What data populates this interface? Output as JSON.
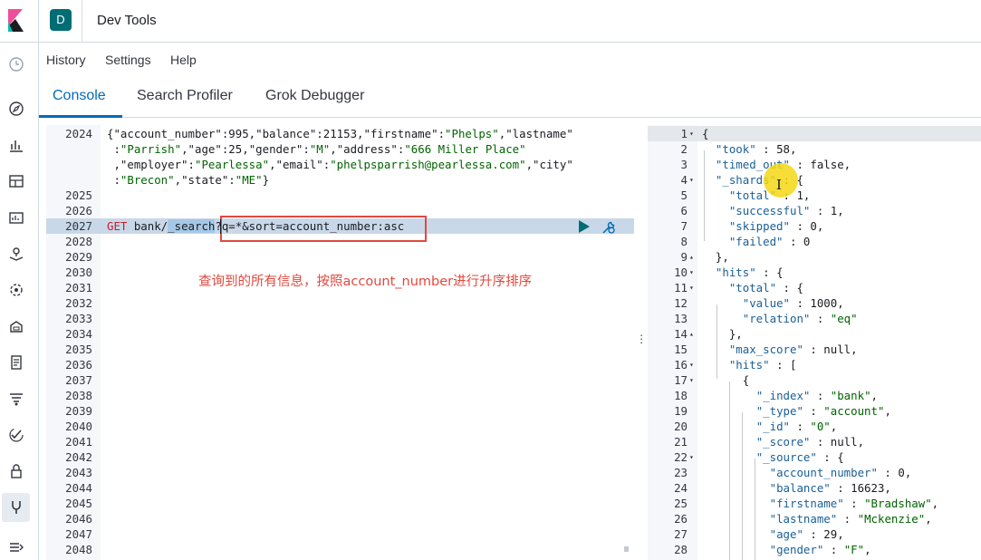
{
  "header": {
    "space_initial": "D",
    "title": "Dev Tools"
  },
  "menu": {
    "history": "History",
    "settings": "Settings",
    "help": "Help"
  },
  "tabs": {
    "console": "Console",
    "search_profiler": "Search Profiler",
    "grok_debugger": "Grok Debugger"
  },
  "left_nav_icons": [
    "clock-icon",
    "discover-compass-icon",
    "visualize-icon",
    "dashboard-icon",
    "canvas-icon",
    "maps-icon",
    "ml-icon",
    "infrastructure-icon",
    "logs-icon",
    "apm-icon",
    "uptime-icon",
    "siem-icon",
    "dev-tools-icon",
    "collapse-menu-icon"
  ],
  "editor": {
    "lines": [
      {
        "num": "2024",
        "tokens": [
          {
            "t": "{",
            "c": "n"
          },
          {
            "t": "\"account_number\"",
            "c": "k"
          },
          {
            "t": ":995,",
            "c": "n"
          },
          {
            "t": "\"balance\"",
            "c": "k"
          },
          {
            "t": ":21153,",
            "c": "n"
          },
          {
            "t": "\"firstname\"",
            "c": "k"
          },
          {
            "t": ":",
            "c": "n"
          },
          {
            "t": "\"Phelps\"",
            "c": "s"
          },
          {
            "t": ",",
            "c": "n"
          },
          {
            "t": "\"lastname\"",
            "c": "k"
          }
        ]
      },
      {
        "num": "",
        "tokens": [
          {
            "t": " :",
            "c": "n"
          },
          {
            "t": "\"Parrish\"",
            "c": "s"
          },
          {
            "t": ",",
            "c": "n"
          },
          {
            "t": "\"age\"",
            "c": "k"
          },
          {
            "t": ":25,",
            "c": "n"
          },
          {
            "t": "\"gender\"",
            "c": "k"
          },
          {
            "t": ":",
            "c": "n"
          },
          {
            "t": "\"M\"",
            "c": "s"
          },
          {
            "t": ",",
            "c": "n"
          },
          {
            "t": "\"address\"",
            "c": "k"
          },
          {
            "t": ":",
            "c": "n"
          },
          {
            "t": "\"666 Miller Place\"",
            "c": "s"
          }
        ]
      },
      {
        "num": "",
        "tokens": [
          {
            "t": " ,",
            "c": "n"
          },
          {
            "t": "\"employer\"",
            "c": "k"
          },
          {
            "t": ":",
            "c": "n"
          },
          {
            "t": "\"Pearlessa\"",
            "c": "s"
          },
          {
            "t": ",",
            "c": "n"
          },
          {
            "t": "\"email\"",
            "c": "k"
          },
          {
            "t": ":",
            "c": "n"
          },
          {
            "t": "\"phelpsparrish@pearlessa.com\"",
            "c": "s"
          },
          {
            "t": ",",
            "c": "n"
          },
          {
            "t": "\"city\"",
            "c": "k"
          }
        ]
      },
      {
        "num": "",
        "tokens": [
          {
            "t": " :",
            "c": "n"
          },
          {
            "t": "\"Brecon\"",
            "c": "s"
          },
          {
            "t": ",",
            "c": "n"
          },
          {
            "t": "\"state\"",
            "c": "k"
          },
          {
            "t": ":",
            "c": "n"
          },
          {
            "t": "\"ME\"",
            "c": "s"
          },
          {
            "t": "}",
            "c": "n"
          }
        ]
      },
      {
        "num": "2025",
        "tokens": []
      },
      {
        "num": "2026",
        "tokens": []
      },
      {
        "num": "2027",
        "active": true,
        "tokens": [
          {
            "t": "GET ",
            "c": "method"
          },
          {
            "t": "bank/",
            "c": "url"
          },
          {
            "t": "_search",
            "c": "search-word"
          },
          {
            "t": "?q=*&sort=account_number:asc",
            "c": "url"
          }
        ]
      },
      {
        "num": "2028",
        "tokens": []
      },
      {
        "num": "2029",
        "tokens": []
      },
      {
        "num": "2030",
        "tokens": []
      },
      {
        "num": "2031",
        "tokens": []
      },
      {
        "num": "2032",
        "tokens": []
      },
      {
        "num": "2033",
        "tokens": []
      },
      {
        "num": "2034",
        "tokens": []
      },
      {
        "num": "2035",
        "tokens": []
      },
      {
        "num": "2036",
        "tokens": []
      },
      {
        "num": "2037",
        "tokens": []
      },
      {
        "num": "2038",
        "tokens": []
      },
      {
        "num": "2039",
        "tokens": []
      },
      {
        "num": "2040",
        "tokens": []
      },
      {
        "num": "2041",
        "tokens": []
      },
      {
        "num": "2042",
        "tokens": []
      },
      {
        "num": "2043",
        "tokens": []
      },
      {
        "num": "2044",
        "tokens": []
      },
      {
        "num": "2045",
        "tokens": []
      },
      {
        "num": "2046",
        "tokens": []
      },
      {
        "num": "2047",
        "tokens": []
      },
      {
        "num": "2048",
        "tokens": []
      }
    ],
    "annotation": "查询到的所有信息，按照account_number进行升序排序"
  },
  "output": {
    "lines": [
      {
        "num": "1",
        "fold": "▾",
        "hl": true,
        "tokens": [
          {
            "t": "{",
            "c": "n"
          }
        ]
      },
      {
        "num": "2",
        "tokens": [
          {
            "t": "  ",
            "c": "n"
          },
          {
            "t": "\"took\"",
            "c": "ok"
          },
          {
            "t": " : 58,",
            "c": "n"
          }
        ]
      },
      {
        "num": "3",
        "tokens": [
          {
            "t": "  ",
            "c": "n"
          },
          {
            "t": "\"timed_out\"",
            "c": "ok"
          },
          {
            "t": " : false,",
            "c": "n"
          }
        ]
      },
      {
        "num": "4",
        "fold": "▾",
        "tokens": [
          {
            "t": "  ",
            "c": "n"
          },
          {
            "t": "\"_shards\"",
            "c": "ok"
          },
          {
            "t": " : {",
            "c": "n"
          }
        ]
      },
      {
        "num": "5",
        "tokens": [
          {
            "t": "    ",
            "c": "n"
          },
          {
            "t": "\"total\"",
            "c": "ok"
          },
          {
            "t": " : 1,",
            "c": "n"
          }
        ]
      },
      {
        "num": "6",
        "tokens": [
          {
            "t": "    ",
            "c": "n"
          },
          {
            "t": "\"successful\"",
            "c": "ok"
          },
          {
            "t": " : 1,",
            "c": "n"
          }
        ]
      },
      {
        "num": "7",
        "tokens": [
          {
            "t": "    ",
            "c": "n"
          },
          {
            "t": "\"skipped\"",
            "c": "ok"
          },
          {
            "t": " : 0,",
            "c": "n"
          }
        ]
      },
      {
        "num": "8",
        "tokens": [
          {
            "t": "    ",
            "c": "n"
          },
          {
            "t": "\"failed\"",
            "c": "ok"
          },
          {
            "t": " : 0",
            "c": "n"
          }
        ]
      },
      {
        "num": "9",
        "fold": "▴",
        "tokens": [
          {
            "t": "  },",
            "c": "n"
          }
        ]
      },
      {
        "num": "10",
        "fold": "▾",
        "tokens": [
          {
            "t": "  ",
            "c": "n"
          },
          {
            "t": "\"hits\"",
            "c": "ok"
          },
          {
            "t": " : {",
            "c": "n"
          }
        ]
      },
      {
        "num": "11",
        "fold": "▾",
        "tokens": [
          {
            "t": "    ",
            "c": "n"
          },
          {
            "t": "\"total\"",
            "c": "ok"
          },
          {
            "t": " : {",
            "c": "n"
          }
        ]
      },
      {
        "num": "12",
        "tokens": [
          {
            "t": "      ",
            "c": "n"
          },
          {
            "t": "\"value\"",
            "c": "ok"
          },
          {
            "t": " : 1000,",
            "c": "n"
          }
        ]
      },
      {
        "num": "13",
        "tokens": [
          {
            "t": "      ",
            "c": "n"
          },
          {
            "t": "\"relation\"",
            "c": "ok"
          },
          {
            "t": " : ",
            "c": "n"
          },
          {
            "t": "\"eq\"",
            "c": "os"
          }
        ]
      },
      {
        "num": "14",
        "fold": "▴",
        "tokens": [
          {
            "t": "    },",
            "c": "n"
          }
        ]
      },
      {
        "num": "15",
        "tokens": [
          {
            "t": "    ",
            "c": "n"
          },
          {
            "t": "\"max_score\"",
            "c": "ok"
          },
          {
            "t": " : null,",
            "c": "n"
          }
        ]
      },
      {
        "num": "16",
        "fold": "▾",
        "tokens": [
          {
            "t": "    ",
            "c": "n"
          },
          {
            "t": "\"hits\"",
            "c": "ok"
          },
          {
            "t": " : [",
            "c": "n"
          }
        ]
      },
      {
        "num": "17",
        "fold": "▾",
        "tokens": [
          {
            "t": "      {",
            "c": "n"
          }
        ]
      },
      {
        "num": "18",
        "tokens": [
          {
            "t": "        ",
            "c": "n"
          },
          {
            "t": "\"_index\"",
            "c": "ok"
          },
          {
            "t": " : ",
            "c": "n"
          },
          {
            "t": "\"bank\"",
            "c": "os"
          },
          {
            "t": ",",
            "c": "n"
          }
        ]
      },
      {
        "num": "19",
        "tokens": [
          {
            "t": "        ",
            "c": "n"
          },
          {
            "t": "\"_type\"",
            "c": "ok"
          },
          {
            "t": " : ",
            "c": "n"
          },
          {
            "t": "\"account\"",
            "c": "os"
          },
          {
            "t": ",",
            "c": "n"
          }
        ]
      },
      {
        "num": "20",
        "tokens": [
          {
            "t": "        ",
            "c": "n"
          },
          {
            "t": "\"_id\"",
            "c": "ok"
          },
          {
            "t": " : ",
            "c": "n"
          },
          {
            "t": "\"0\"",
            "c": "os"
          },
          {
            "t": ",",
            "c": "n"
          }
        ]
      },
      {
        "num": "21",
        "tokens": [
          {
            "t": "        ",
            "c": "n"
          },
          {
            "t": "\"_score\"",
            "c": "ok"
          },
          {
            "t": " : null,",
            "c": "n"
          }
        ]
      },
      {
        "num": "22",
        "fold": "▾",
        "tokens": [
          {
            "t": "        ",
            "c": "n"
          },
          {
            "t": "\"_source\"",
            "c": "ok"
          },
          {
            "t": " : {",
            "c": "n"
          }
        ]
      },
      {
        "num": "23",
        "tokens": [
          {
            "t": "          ",
            "c": "n"
          },
          {
            "t": "\"account_number\"",
            "c": "ok"
          },
          {
            "t": " : 0,",
            "c": "n"
          }
        ]
      },
      {
        "num": "24",
        "tokens": [
          {
            "t": "          ",
            "c": "n"
          },
          {
            "t": "\"balance\"",
            "c": "ok"
          },
          {
            "t": " : 16623,",
            "c": "n"
          }
        ]
      },
      {
        "num": "25",
        "tokens": [
          {
            "t": "          ",
            "c": "n"
          },
          {
            "t": "\"firstname\"",
            "c": "ok"
          },
          {
            "t": " : ",
            "c": "n"
          },
          {
            "t": "\"Bradshaw\"",
            "c": "os"
          },
          {
            "t": ",",
            "c": "n"
          }
        ]
      },
      {
        "num": "26",
        "tokens": [
          {
            "t": "          ",
            "c": "n"
          },
          {
            "t": "\"lastname\"",
            "c": "ok"
          },
          {
            "t": " : ",
            "c": "n"
          },
          {
            "t": "\"Mckenzie\"",
            "c": "os"
          },
          {
            "t": ",",
            "c": "n"
          }
        ]
      },
      {
        "num": "27",
        "tokens": [
          {
            "t": "          ",
            "c": "n"
          },
          {
            "t": "\"age\"",
            "c": "ok"
          },
          {
            "t": " : 29,",
            "c": "n"
          }
        ]
      },
      {
        "num": "28",
        "tokens": [
          {
            "t": "          ",
            "c": "n"
          },
          {
            "t": "\"gender\"",
            "c": "ok"
          },
          {
            "t": " : ",
            "c": "n"
          },
          {
            "t": "\"F\"",
            "c": "os"
          },
          {
            "t": ",",
            "c": "n"
          }
        ]
      }
    ]
  },
  "colors": {
    "accent": "#006bb8",
    "annotation_red": "#e2483d",
    "cursor_yellow": "#f5d714",
    "space_badge": "#006d75"
  }
}
